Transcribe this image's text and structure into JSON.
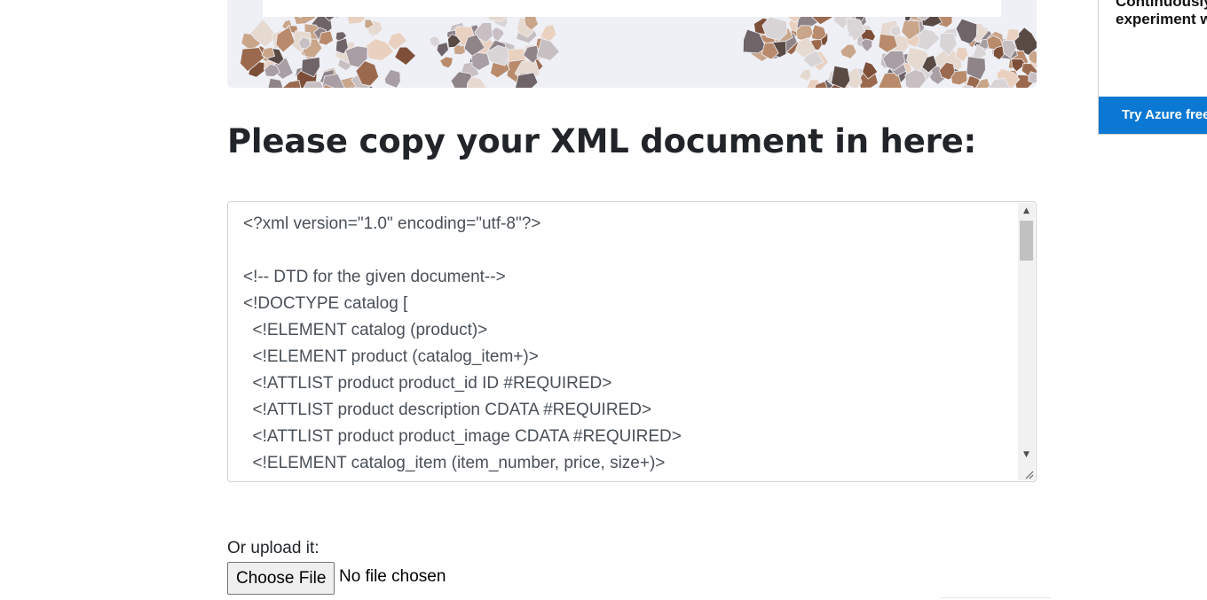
{
  "ad": {
    "text": "Continuously\nexperiment w",
    "button_label": "Try Azure free"
  },
  "form": {
    "heading": "Please copy your XML document in here:",
    "xml_lines": [
      "<?xml version=\"1.0\" encoding=\"utf-8\"?>",
      "",
      "<!-- DTD for the given document-->",
      "<!DOCTYPE catalog [",
      "  <!ELEMENT catalog (product)>",
      "  <!ELEMENT product (catalog_item+)>",
      "  <!ATTLIST product product_id ID #REQUIRED>",
      "  <!ATTLIST product description CDATA #REQUIRED>",
      "  <!ATTLIST product product_image CDATA #REQUIRED>",
      "  <!ELEMENT catalog_item (item_number, price, size+)>"
    ],
    "upload_label": "Or upload it:",
    "choose_file_label": "Choose File",
    "file_status": "No file chosen"
  },
  "icons": {
    "scroll_up": "scroll-up-arrow-icon",
    "scroll_down": "scroll-down-arrow-icon",
    "resize": "resize-grip-icon"
  },
  "colors": {
    "ad_button": "#0b78d4",
    "heading": "#212529"
  }
}
